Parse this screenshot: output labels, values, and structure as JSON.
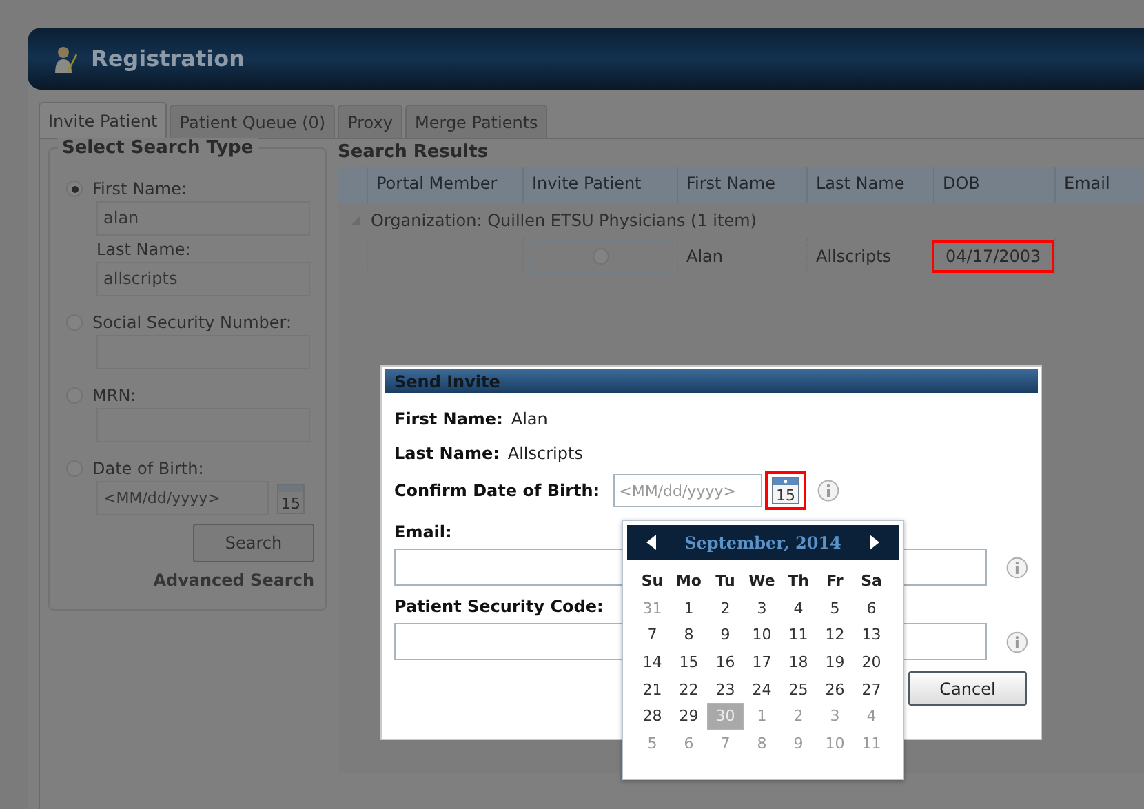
{
  "window": {
    "title": "Registration"
  },
  "tabs": [
    {
      "label": "Invite Patient",
      "selected": true
    },
    {
      "label": "Patient Queue (0)",
      "selected": false
    },
    {
      "label": "Proxy",
      "selected": false
    },
    {
      "label": "Merge Patients",
      "selected": false
    }
  ],
  "search_type": {
    "title": "Select Search Type",
    "options": [
      {
        "label": "First Name:",
        "selected": true,
        "kind": "text",
        "value": "alan"
      },
      {
        "label": "Last Name:",
        "kind": "sub",
        "value": "allscripts"
      },
      {
        "label": "Social Security Number:",
        "selected": false,
        "kind": "text"
      },
      {
        "label": "MRN:",
        "selected": false,
        "kind": "text"
      },
      {
        "label": "Date of Birth:",
        "selected": false,
        "kind": "date",
        "placeholder": "<MM/dd/yyyy>",
        "calendar_label": "15"
      }
    ],
    "search_button": "Search",
    "advanced_link": "Advanced Search"
  },
  "results": {
    "title": "Search Results",
    "columns": [
      "Portal Member",
      "Invite Patient",
      "First Name",
      "Last Name",
      "DOB",
      "Email"
    ],
    "group": "Organization: Quillen ETSU Physicians (1 item)",
    "rows": [
      {
        "first_name": "Alan",
        "last_name": "Allscripts",
        "dob": "04/17/2003",
        "dob_marked": true,
        "invite_selected": false
      }
    ]
  },
  "dialog": {
    "title": "Send Invite",
    "first_name_label": "First Name:",
    "first_name": "Alan",
    "last_name_label": "Last Name:",
    "last_name": "Allscripts",
    "dob_label": "Confirm Date of Birth:",
    "dob_placeholder": "<MM/dd/yyyy>",
    "calendar_label": "15",
    "calendar_marked": true,
    "email_label": "Email:",
    "code_label": "Patient Security Code:",
    "cancel": "Cancel"
  },
  "calendar": {
    "title": "September, 2014",
    "weekdays": [
      "Su",
      "Mo",
      "Tu",
      "We",
      "Th",
      "Fr",
      "Sa"
    ],
    "days": [
      {
        "day": "31",
        "other_month": true,
        "selected": false
      },
      {
        "day": "1",
        "other_month": false,
        "selected": false
      },
      {
        "day": "2",
        "other_month": false,
        "selected": false
      },
      {
        "day": "3",
        "other_month": false,
        "selected": false
      },
      {
        "day": "4",
        "other_month": false,
        "selected": false
      },
      {
        "day": "5",
        "other_month": false,
        "selected": false
      },
      {
        "day": "6",
        "other_month": false,
        "selected": false
      },
      {
        "day": "7",
        "other_month": false,
        "selected": false
      },
      {
        "day": "8",
        "other_month": false,
        "selected": false
      },
      {
        "day": "9",
        "other_month": false,
        "selected": false
      },
      {
        "day": "10",
        "other_month": false,
        "selected": false
      },
      {
        "day": "11",
        "other_month": false,
        "selected": false
      },
      {
        "day": "12",
        "other_month": false,
        "selected": false
      },
      {
        "day": "13",
        "other_month": false,
        "selected": false
      },
      {
        "day": "14",
        "other_month": false,
        "selected": false
      },
      {
        "day": "15",
        "other_month": false,
        "selected": false
      },
      {
        "day": "16",
        "other_month": false,
        "selected": false
      },
      {
        "day": "17",
        "other_month": false,
        "selected": false
      },
      {
        "day": "18",
        "other_month": false,
        "selected": false
      },
      {
        "day": "19",
        "other_month": false,
        "selected": false
      },
      {
        "day": "20",
        "other_month": false,
        "selected": false
      },
      {
        "day": "21",
        "other_month": false,
        "selected": false
      },
      {
        "day": "22",
        "other_month": false,
        "selected": false
      },
      {
        "day": "23",
        "other_month": false,
        "selected": false
      },
      {
        "day": "24",
        "other_month": false,
        "selected": false
      },
      {
        "day": "25",
        "other_month": false,
        "selected": false
      },
      {
        "day": "26",
        "other_month": false,
        "selected": false
      },
      {
        "day": "27",
        "other_month": false,
        "selected": false
      },
      {
        "day": "28",
        "other_month": false,
        "selected": false
      },
      {
        "day": "29",
        "other_month": false,
        "selected": false
      },
      {
        "day": "30",
        "other_month": false,
        "selected": true
      },
      {
        "day": "1",
        "other_month": true,
        "selected": false
      },
      {
        "day": "2",
        "other_month": true,
        "selected": false
      },
      {
        "day": "3",
        "other_month": true,
        "selected": false
      },
      {
        "day": "4",
        "other_month": true,
        "selected": false
      },
      {
        "day": "5",
        "other_month": true,
        "selected": false
      },
      {
        "day": "6",
        "other_month": true,
        "selected": false
      },
      {
        "day": "7",
        "other_month": true,
        "selected": false
      },
      {
        "day": "8",
        "other_month": true,
        "selected": false
      },
      {
        "day": "9",
        "other_month": true,
        "selected": false
      },
      {
        "day": "10",
        "other_month": true,
        "selected": false
      },
      {
        "day": "11",
        "other_month": true,
        "selected": false
      }
    ]
  }
}
